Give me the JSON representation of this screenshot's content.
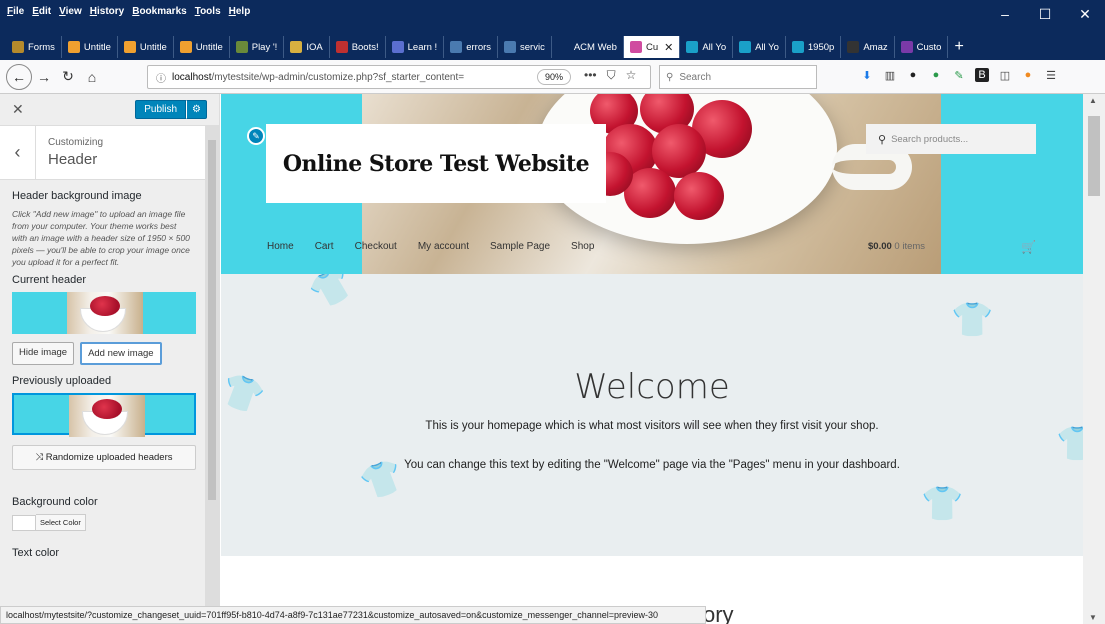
{
  "menubar": {
    "items": [
      "File",
      "Edit",
      "View",
      "History",
      "Bookmarks",
      "Tools",
      "Help"
    ]
  },
  "window_controls": {
    "minimize": "–",
    "maximize": "☐",
    "close": "✕"
  },
  "tabs": [
    {
      "label": "Forms",
      "color": "#b58a2c"
    },
    {
      "label": "Untitle",
      "color": "#f0a030"
    },
    {
      "label": "Untitle",
      "color": "#f0a030"
    },
    {
      "label": "Untitle",
      "color": "#f0a030"
    },
    {
      "label": "Play '!",
      "color": "#6a8a3a"
    },
    {
      "label": "IOA",
      "color": "#d8b040"
    },
    {
      "label": "Boots!",
      "color": "#c03030"
    },
    {
      "label": "Learn !",
      "color": "#5b6fd0"
    },
    {
      "label": "errors",
      "color": "#4a7ab0"
    },
    {
      "label": "servic",
      "color": "#4a7ab0"
    },
    {
      "label": "ACM Web",
      "color": "#0c2a5c"
    },
    {
      "label": "Cu",
      "color": "#d04ca0",
      "active": true
    },
    {
      "label": "All Yo",
      "color": "#1aa0c8"
    },
    {
      "label": "All Yo",
      "color": "#1aa0c8"
    },
    {
      "label": "1950p",
      "color": "#1aa0c8"
    },
    {
      "label": "Amaz",
      "color": "#333333"
    },
    {
      "label": "Custo",
      "color": "#7a3aa8"
    }
  ],
  "newtab": "+",
  "nav": {
    "url_host": "localhost",
    "url_path": "/mytestsite/wp-admin/customize.php?sf_starter_content=",
    "zoom": "90%",
    "search_placeholder": "Search"
  },
  "customizer": {
    "close": "✕",
    "publish": "Publish",
    "gear": "⚙",
    "back": "‹",
    "subtitle": "Customizing",
    "title": "Header",
    "section_label": "Header background image",
    "description": "Click \"Add new image\" to upload an image file from your computer. Your theme works best with an image with a header size of 1950 × 500 pixels — you'll be able to crop your image once you upload it for a perfect fit.",
    "current_header": "Current header",
    "hide_image": "Hide image",
    "add_new_image": "Add new image",
    "previously_uploaded": "Previously uploaded",
    "randomize": "Randomize uploaded headers",
    "background_color": "Background color",
    "select_color": "Select Color",
    "text_color": "Text color"
  },
  "site": {
    "title": "Online Store Test Website",
    "search_placeholder": "Search products...",
    "nav": [
      "Home",
      "Cart",
      "Checkout",
      "My account",
      "Sample Page",
      "Shop"
    ],
    "cart_amount": "$0.00",
    "cart_items": "0 items",
    "welcome": "Welcome",
    "intro1": "This is your homepage which is what most visitors will see when they first visit your shop.",
    "intro2": "You can change this text by editing the \"Welcome\" page via the \"Pages\" menu in your dashboard.",
    "partial_heading": "ory"
  },
  "statusbar": "localhost/mytestsite/?customize_changeset_uuid=701ff95f-b810-4d74-a8f9-7c131ae77231&customize_autosaved=on&customize_messenger_channel=preview-30",
  "colors": {
    "header_accent": "#47d5e6",
    "publish_blue": "#0085ba",
    "chrome_bg": "#0c2a5c"
  }
}
